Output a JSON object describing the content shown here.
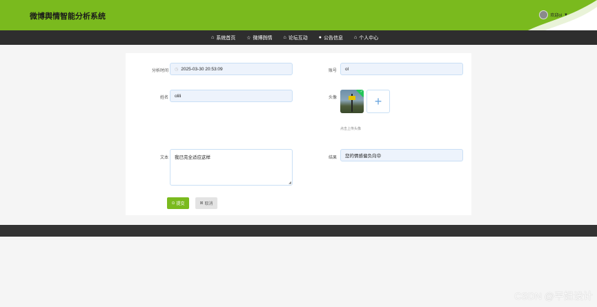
{
  "header": {
    "title": "微博舆情智能分析系统",
    "user": {
      "greeting": "欢迎ol",
      "caret": "▼"
    },
    "colors": {
      "brand": "#7aba1e",
      "nav": "#2e2e2e"
    }
  },
  "nav": {
    "items": [
      {
        "label": "系统首页",
        "icon": "home-icon",
        "glyph": "⌂"
      },
      {
        "label": "微博舆情",
        "icon": "star-icon",
        "glyph": "☆"
      },
      {
        "label": "论坛互动",
        "icon": "lock-icon",
        "glyph": "⌂"
      },
      {
        "label": "公告信息",
        "icon": "info-icon",
        "glyph": "●"
      },
      {
        "label": "个人中心",
        "icon": "home-icon",
        "glyph": "⌂"
      }
    ]
  },
  "form": {
    "analysis_time": {
      "label": "分析时间",
      "value": "2025-03-30 20:53:09"
    },
    "account": {
      "label": "账号",
      "value": "ol"
    },
    "name": {
      "label": "姓名",
      "value": "olili"
    },
    "avatar": {
      "label": "头像",
      "hint": "点击上传头像",
      "plus": "+"
    },
    "text": {
      "label": "文本",
      "value": "我已完全适应这样"
    },
    "result": {
      "label": "结果",
      "value": "您的情感偏负向😡"
    },
    "submit_label": "提交",
    "cancel_label": "取消"
  },
  "watermark": "CSDN @平姐设计"
}
